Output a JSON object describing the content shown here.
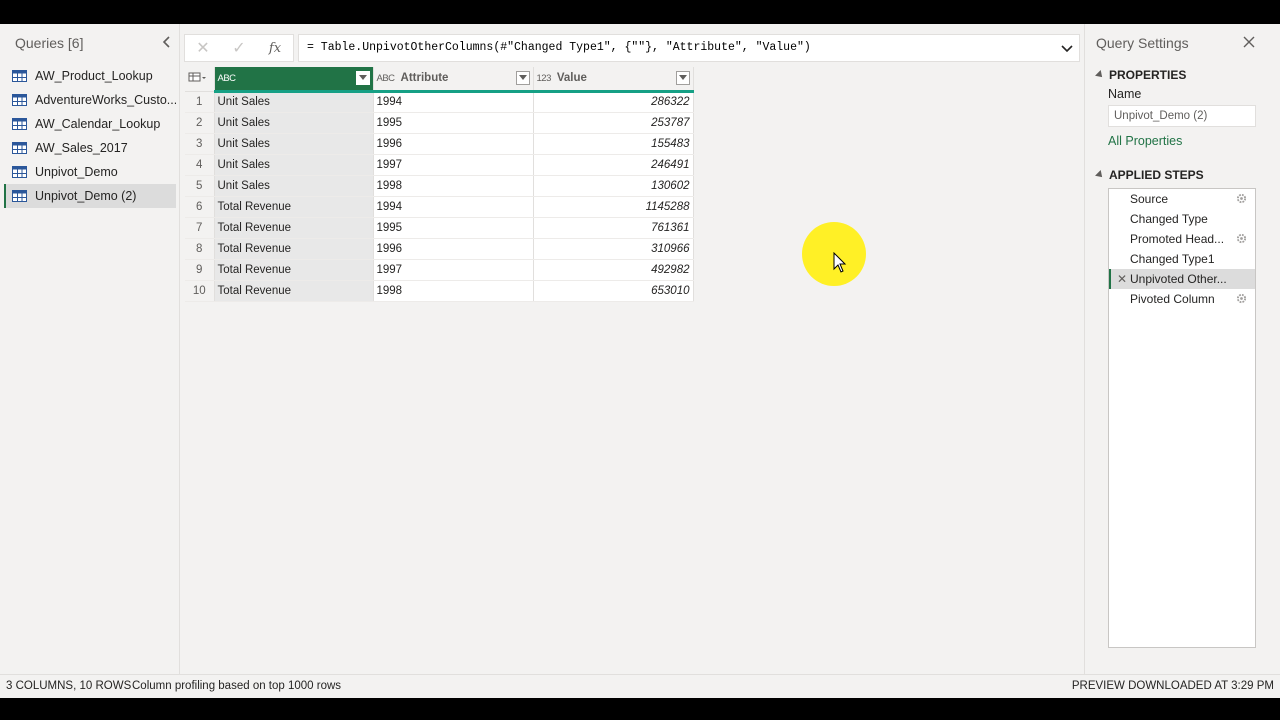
{
  "queries": {
    "title": "Queries [6]",
    "items": [
      {
        "label": "AW_Product_Lookup"
      },
      {
        "label": "AdventureWorks_Custo..."
      },
      {
        "label": "AW_Calendar_Lookup"
      },
      {
        "label": "AW_Sales_2017"
      },
      {
        "label": "Unpivot_Demo"
      },
      {
        "label": "Unpivot_Demo (2)",
        "selected": true
      }
    ]
  },
  "formula": {
    "fx": "fx",
    "text": "= Table.UnpivotOtherColumns(#\"Changed Type1\", {\"\"}, \"Attribute\", \"Value\")"
  },
  "grid": {
    "columns": [
      {
        "type": "ABC",
        "label": ""
      },
      {
        "type": "ABC",
        "label": "Attribute"
      },
      {
        "type": "123",
        "label": "Value"
      }
    ],
    "rows": [
      {
        "n": "1",
        "a": "Unit Sales",
        "b": "1994",
        "c": "286322"
      },
      {
        "n": "2",
        "a": "Unit Sales",
        "b": "1995",
        "c": "253787"
      },
      {
        "n": "3",
        "a": "Unit Sales",
        "b": "1996",
        "c": "155483"
      },
      {
        "n": "4",
        "a": "Unit Sales",
        "b": "1997",
        "c": "246491"
      },
      {
        "n": "5",
        "a": "Unit Sales",
        "b": "1998",
        "c": "130602"
      },
      {
        "n": "6",
        "a": "Total Revenue",
        "b": "1994",
        "c": "1145288"
      },
      {
        "n": "7",
        "a": "Total Revenue",
        "b": "1995",
        "c": "761361"
      },
      {
        "n": "8",
        "a": "Total Revenue",
        "b": "1996",
        "c": "310966"
      },
      {
        "n": "9",
        "a": "Total Revenue",
        "b": "1997",
        "c": "492982"
      },
      {
        "n": "10",
        "a": "Total Revenue",
        "b": "1998",
        "c": "653010"
      }
    ]
  },
  "settings": {
    "title": "Query Settings",
    "properties_title": "PROPERTIES",
    "name_label": "Name",
    "name_value": "Unpivot_Demo (2)",
    "all_properties": "All Properties",
    "steps_title": "APPLIED STEPS",
    "steps": [
      {
        "label": "Source",
        "gear": true
      },
      {
        "label": "Changed Type",
        "gear": false
      },
      {
        "label": "Promoted Head...",
        "gear": true
      },
      {
        "label": "Changed Type1",
        "gear": false
      },
      {
        "label": "Unpivoted Other...",
        "gear": false,
        "selected": true
      },
      {
        "label": "Pivoted Column",
        "gear": true
      }
    ]
  },
  "status": {
    "shape": "3 COLUMNS, 10 ROWS",
    "profiling": "Column profiling based on top 1000 rows",
    "preview": "PREVIEW DOWNLOADED AT 3:29 PM"
  },
  "colors": {
    "accent": "#217346",
    "header_underline": "#16a085",
    "cursor_highlight": "#ffef1a"
  }
}
